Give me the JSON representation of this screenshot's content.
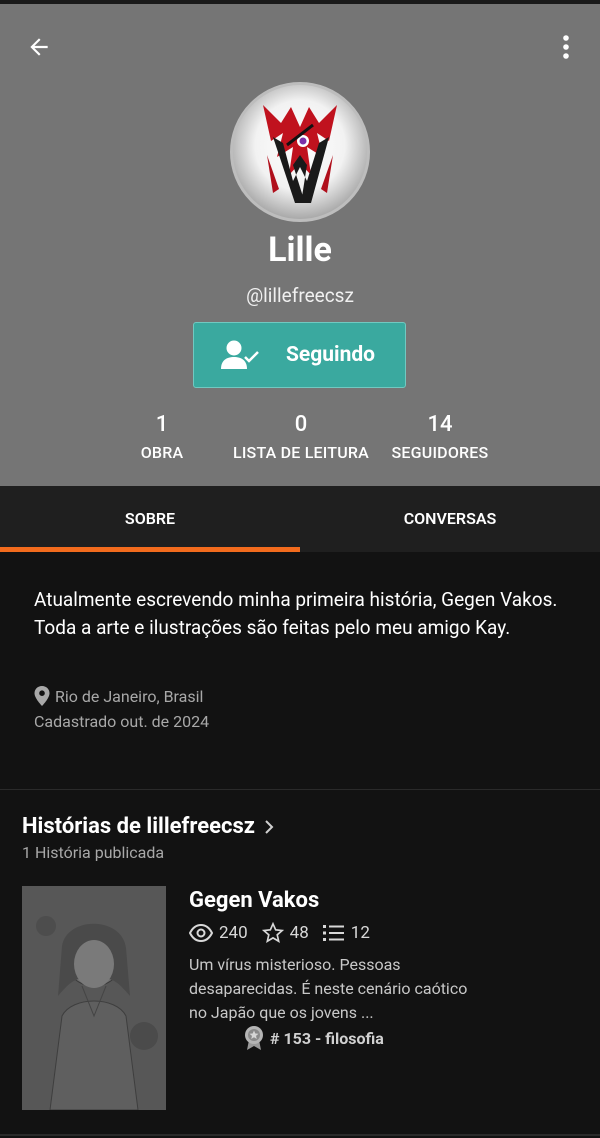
{
  "profile": {
    "name": "Lille",
    "handle": "@lillefreecsz",
    "follow_label": "Seguindo"
  },
  "stats": [
    {
      "value": "1",
      "label": "OBRA"
    },
    {
      "value": "0",
      "label": "LISTA DE LEITURA"
    },
    {
      "value": "14",
      "label": "SEGUIDORES"
    }
  ],
  "tabs": [
    {
      "label": "SOBRE",
      "active": true
    },
    {
      "label": "CONVERSAS",
      "active": false
    }
  ],
  "about": {
    "bio": "Atualmente escrevendo minha primeira história, Gegen Vakos. Toda a arte e ilustrações são feitas pelo meu amigo Kay.",
    "location": "Rio de Janeiro, Brasil",
    "joined": "Cadastrado out. de 2024"
  },
  "stories": {
    "title": "Histórias de lillefreecsz",
    "subtitle": "1 História publicada",
    "items": [
      {
        "title": "Gegen Vakos",
        "views": "240",
        "votes": "48",
        "parts": "12",
        "description": "Um vírus misterioso. Pessoas desaparecidas. É neste cenário caótico no Japão que os jovens ...",
        "rank": "# 153 - filosofia"
      }
    ]
  },
  "colors": {
    "header_bg": "#757575",
    "accent_teal": "#3aa99f",
    "tab_indicator": "#f26b1d",
    "page_bg": "#121212"
  },
  "icons": {
    "back": "arrow-left-icon",
    "more": "more-vertical-icon",
    "follow": "user-check-icon",
    "location": "location-pin-icon",
    "chevron": "chevron-right-icon",
    "views": "eye-icon",
    "votes": "star-icon",
    "parts": "list-icon",
    "rank": "award-badge-icon"
  }
}
